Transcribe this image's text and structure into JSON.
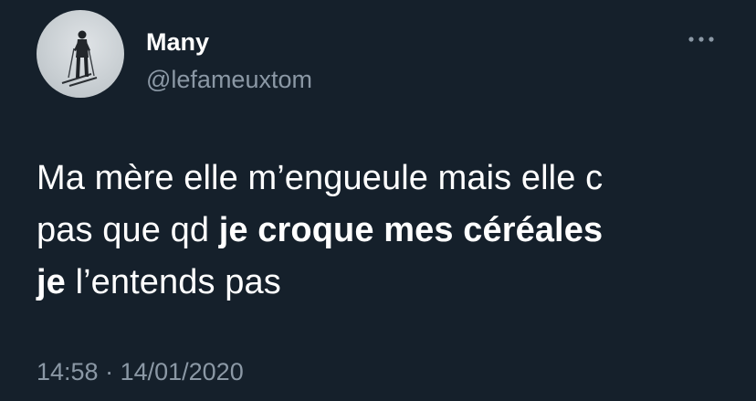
{
  "author": {
    "display_name": "Many",
    "handle": "@lefameuxtom"
  },
  "tweet": {
    "line1": "Ma mère elle m’engueule mais elle c",
    "line2_plain": "pas que qd ",
    "line2_bold": "je croque mes céréales",
    "line3_bold": "je",
    "line3_plain": " l’entends pas"
  },
  "meta": {
    "time": "14:58",
    "separator": " · ",
    "date": "14/01/2020"
  },
  "icons": {
    "avatar": "skier-photo",
    "more": "more-options-icon"
  },
  "colors": {
    "background": "#15202b",
    "primary_text": "#ffffff",
    "secondary_text": "#8b98a5"
  }
}
